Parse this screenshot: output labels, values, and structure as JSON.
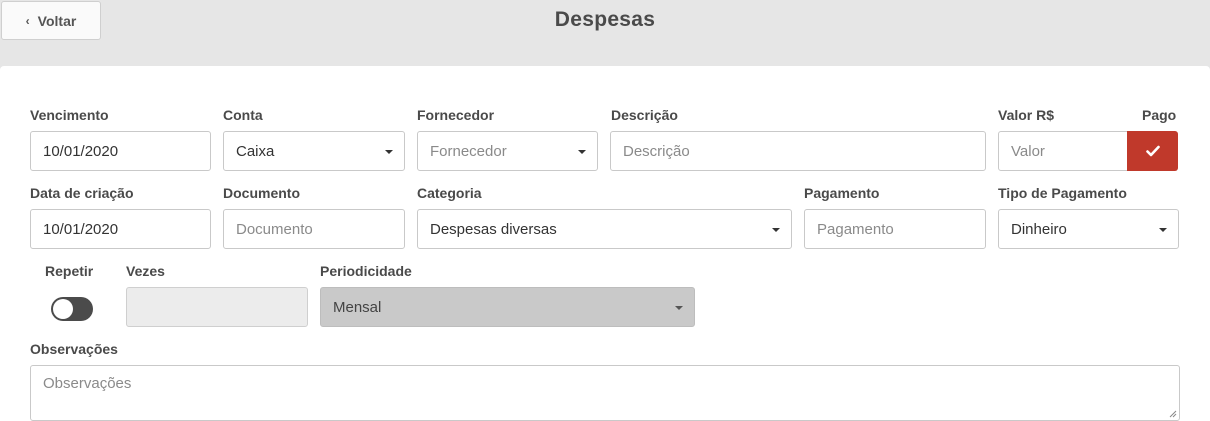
{
  "header": {
    "back_label": "Voltar",
    "title": "Despesas"
  },
  "form": {
    "vencimento": {
      "label": "Vencimento",
      "value": "10/01/2020"
    },
    "conta": {
      "label": "Conta",
      "value": "Caixa"
    },
    "fornecedor": {
      "label": "Fornecedor",
      "placeholder": "Fornecedor"
    },
    "descricao": {
      "label": "Descrição",
      "placeholder": "Descrição"
    },
    "valor": {
      "label": "Valor R$",
      "placeholder": "Valor"
    },
    "pago": {
      "label": "Pago",
      "icon": "check-icon",
      "color": "#c0392b"
    },
    "data_criacao": {
      "label": "Data de criação",
      "value": "10/01/2020"
    },
    "documento": {
      "label": "Documento",
      "placeholder": "Documento"
    },
    "categoria": {
      "label": "Categoria",
      "value": "Despesas diversas"
    },
    "pagamento": {
      "label": "Pagamento",
      "placeholder": "Pagamento"
    },
    "tipo_pagamento": {
      "label": "Tipo de Pagamento",
      "value": "Dinheiro"
    },
    "repetir": {
      "label": "Repetir",
      "on": false
    },
    "vezes": {
      "label": "Vezes",
      "value": ""
    },
    "periodicidade": {
      "label": "Periodicidade",
      "value": "Mensal"
    },
    "observacoes": {
      "label": "Observações",
      "placeholder": "Observações"
    }
  }
}
